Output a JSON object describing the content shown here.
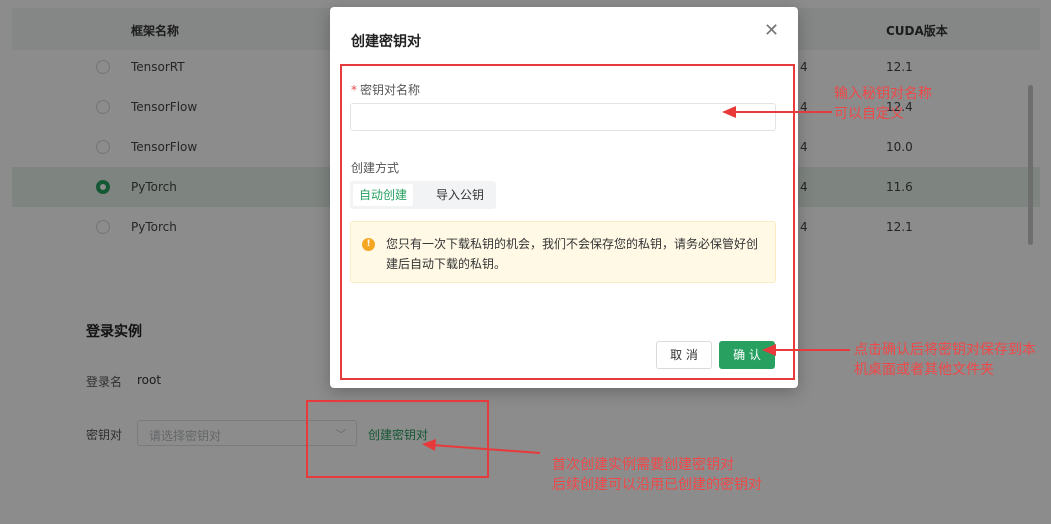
{
  "table": {
    "headers": {
      "framework": "框架名称",
      "cuda": "CUDA版本"
    },
    "rows": [
      {
        "framework": "TensorRT",
        "mid": "4",
        "cuda": "12.1",
        "selected": false
      },
      {
        "framework": "TensorFlow",
        "mid": "4",
        "cuda": "12.4",
        "selected": false
      },
      {
        "framework": "TensorFlow",
        "mid": "4",
        "cuda": "10.0",
        "selected": false
      },
      {
        "framework": "PyTorch",
        "mid": "4",
        "cuda": "11.6",
        "selected": true
      },
      {
        "framework": "PyTorch",
        "mid": "4",
        "cuda": "12.1",
        "selected": false
      }
    ]
  },
  "login": {
    "title": "登录实例",
    "username_label": "登录名",
    "username_value": "root",
    "keypair_label": "密钥对",
    "keypair_placeholder": "请选择密钥对",
    "create_link": "创建密钥对"
  },
  "modal": {
    "title": "创建密钥对",
    "close": "✕",
    "name_label": "密钥对名称",
    "required_mark": "*",
    "name_value": "",
    "mode_label": "创建方式",
    "modes": {
      "auto": "自动创建",
      "import": "导入公钥"
    },
    "active_mode": "auto",
    "warning": "您只有一次下载私钥的机会，我们不会保存您的私钥，请务必保管好创建后自动下载的私钥。",
    "cancel": "取 消",
    "confirm": "确 认"
  },
  "annotations": {
    "name_hint_line1": "输入秘钥对名称",
    "name_hint_line2": "可以自定义",
    "confirm_hint": "点击确认后将密钥对保存到本机桌面或者其他文件夹",
    "create_hint_line1": "首次创建实例需要创建密钥对",
    "create_hint_line2": "后续创建可以沿用已创建的密钥对"
  },
  "colors": {
    "accent": "#27a060",
    "annotation": "#e83a3a",
    "warning_bg": "#fff9e6"
  }
}
